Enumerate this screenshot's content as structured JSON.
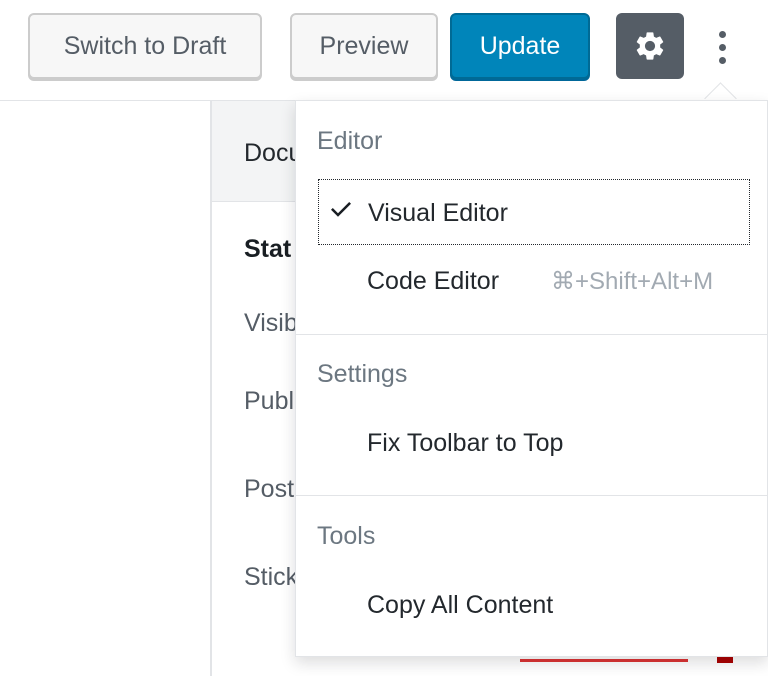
{
  "toolbar": {
    "switch_to_draft": "Switch to Draft",
    "preview": "Preview",
    "update": "Update",
    "settings_icon": "gear-icon",
    "more_icon": "more-vertical-icon"
  },
  "sidebar": {
    "tab_document": "Docu",
    "status_title": "Stat",
    "rows": [
      "Visib",
      "Publ",
      "Post",
      "Stick"
    ]
  },
  "menu": {
    "editor_label": "Editor",
    "visual_editor": "Visual Editor",
    "code_editor": "Code Editor",
    "code_editor_shortcut": "⌘+Shift+Alt+M",
    "settings_label": "Settings",
    "fix_toolbar": "Fix Toolbar to Top",
    "tools_label": "Tools",
    "copy_all": "Copy All Content"
  },
  "colors": {
    "primary": "#0085ba",
    "dark_button": "#555d66"
  }
}
